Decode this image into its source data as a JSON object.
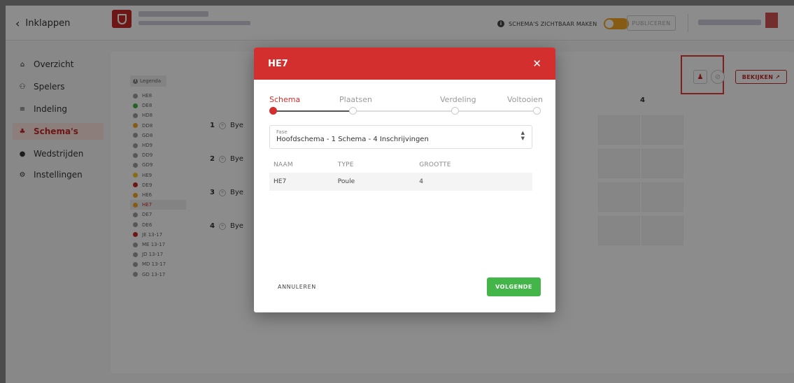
{
  "topbar": {
    "collapse_label": "Inklappen",
    "visibility_label": "SCHEMA'S ZICHTBAAR MAKEN",
    "publish_label": "PUBLICEREN"
  },
  "sidebar": {
    "items": [
      {
        "label": "Overzicht",
        "icon": "home-icon",
        "glyph": "⌂"
      },
      {
        "label": "Spelers",
        "icon": "players-icon",
        "glyph": "⚇"
      },
      {
        "label": "Indeling",
        "icon": "list-icon",
        "glyph": "≡"
      },
      {
        "label": "Schema's",
        "icon": "bracket-icon",
        "glyph": "♣",
        "active": true
      },
      {
        "label": "Wedstrijden",
        "icon": "ball-icon",
        "glyph": "●"
      },
      {
        "label": "Instellingen",
        "icon": "gear-icon",
        "glyph": "⚙"
      }
    ]
  },
  "legend": {
    "title": "Legenda",
    "items": [
      {
        "label": "HE8",
        "color": "#9e9e9e"
      },
      {
        "label": "DE8",
        "color": "#43b549"
      },
      {
        "label": "HD8",
        "color": "#9e9e9e"
      },
      {
        "label": "DD8",
        "color": "#f5a623"
      },
      {
        "label": "GD8",
        "color": "#9e9e9e"
      },
      {
        "label": "HD9",
        "color": "#9e9e9e"
      },
      {
        "label": "DD9",
        "color": "#9e9e9e"
      },
      {
        "label": "GD9",
        "color": "#9e9e9e"
      },
      {
        "label": "HE9",
        "color": "#f5c623"
      },
      {
        "label": "DE9",
        "color": "#c62828"
      },
      {
        "label": "HE6",
        "color": "#f5a623"
      },
      {
        "label": "HE7",
        "color": "#f5a623",
        "selected": true
      },
      {
        "label": "DE7",
        "color": "#9e9e9e"
      },
      {
        "label": "DE6",
        "color": "#9e9e9e"
      },
      {
        "label": "JE 13-17",
        "color": "#c62828"
      },
      {
        "label": "ME 13-17",
        "color": "#9e9e9e"
      },
      {
        "label": "JD 13-17",
        "color": "#9e9e9e"
      },
      {
        "label": "MD 13-17",
        "color": "#9e9e9e"
      },
      {
        "label": "GD 13-17",
        "color": "#9e9e9e"
      }
    ]
  },
  "bracket": {
    "rows": [
      {
        "num": "1",
        "entry": "Bye"
      },
      {
        "num": "2",
        "entry": "Bye"
      },
      {
        "num": "3",
        "entry": "Bye"
      },
      {
        "num": "4",
        "entry": "Bye"
      }
    ],
    "column_header": "4"
  },
  "toolbar": {
    "view_label": "BEKIJKEN"
  },
  "modal": {
    "title": "HE7",
    "steps": [
      {
        "label": "Schema",
        "active": true
      },
      {
        "label": "Plaatsen"
      },
      {
        "label": "Verdeling"
      },
      {
        "label": "Voltooien"
      }
    ],
    "fase": {
      "label": "Fase",
      "value": "Hoofdschema - 1 Schema - 4 Inschrijvingen"
    },
    "table": {
      "headers": [
        "NAAM",
        "TYPE",
        "GROOTTE"
      ],
      "rows": [
        [
          "HE7",
          "Poule",
          "4"
        ]
      ]
    },
    "cancel_label": "ANNULEREN",
    "next_label": "VOLGENDE"
  },
  "colors": {
    "accent": "#d32f2f",
    "success": "#43b549",
    "warning": "#f5a623"
  }
}
